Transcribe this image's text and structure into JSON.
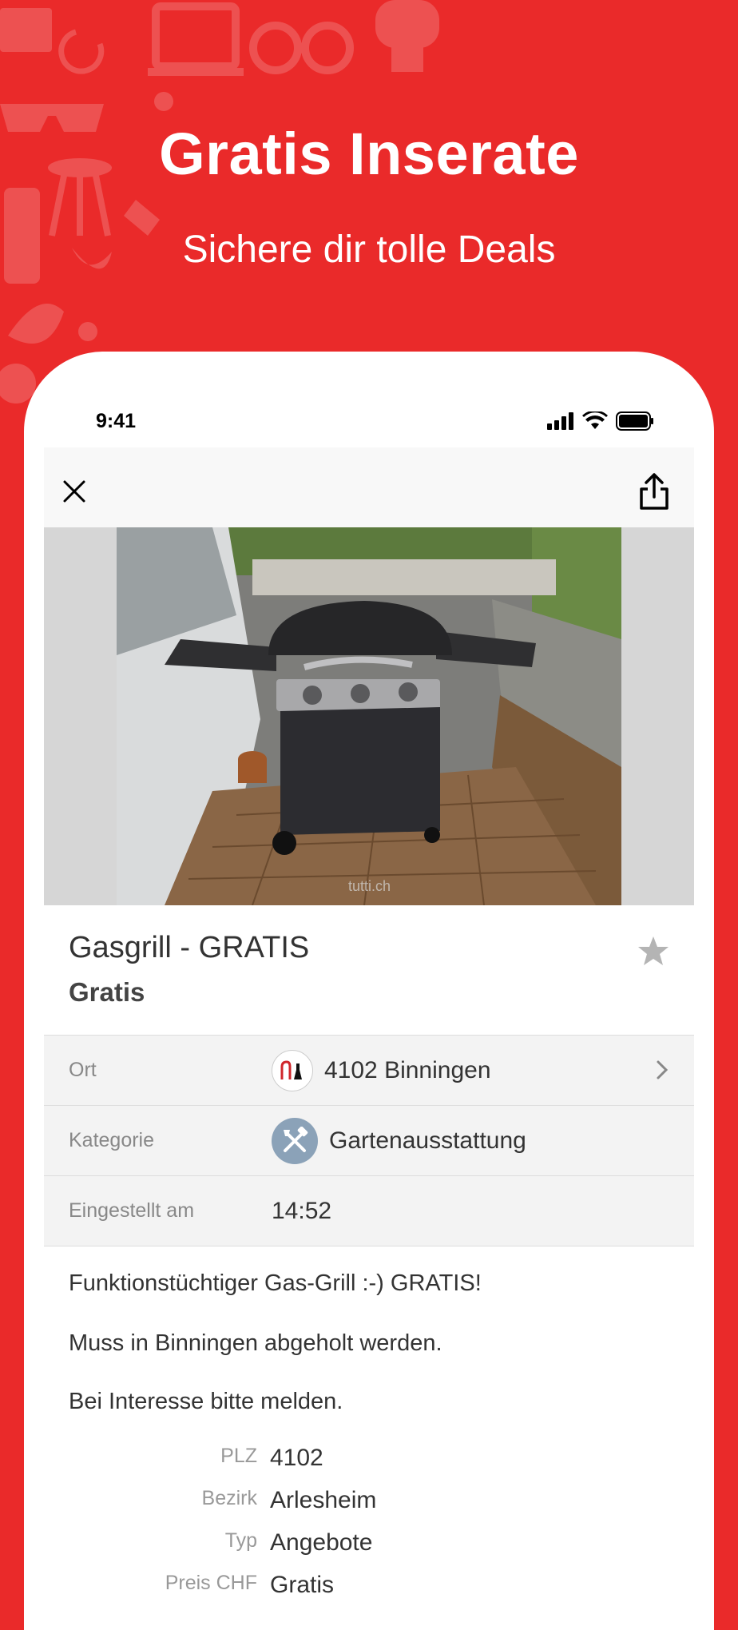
{
  "hero": {
    "title": "Gratis Inserate",
    "subtitle": "Sichere dir tolle Deals"
  },
  "colors": {
    "background": "#ea2a2a",
    "category_badge": "#8ba2b8"
  },
  "status_bar": {
    "time": "9:41",
    "icons": [
      "cellular-signal-icon",
      "wifi-icon",
      "battery-icon"
    ]
  },
  "nav": {
    "close_icon": "close-icon",
    "share_icon": "share-icon"
  },
  "photo": {
    "watermark": "tutti.ch"
  },
  "listing": {
    "title": "Gasgrill - GRATIS",
    "price": "Gratis",
    "favorite_icon": "star-icon"
  },
  "info_rows": [
    {
      "label": "Ort",
      "value": "4102 Binningen",
      "icon": "canton-coat-of-arms-icon"
    },
    {
      "label": "Kategorie",
      "value": "Gartenausstattung",
      "icon": "garden-tools-icon"
    },
    {
      "label": "Eingestellt am",
      "value": "14:52"
    }
  ],
  "description": [
    "Funktionstüchtiger Gas-Grill :-) GRATIS!",
    "Muss in Binningen abgeholt werden.",
    "Bei Interesse bitte melden."
  ],
  "details": [
    {
      "label": "PLZ",
      "value": "4102"
    },
    {
      "label": "Bezirk",
      "value": "Arlesheim"
    },
    {
      "label": "Typ",
      "value": "Angebote"
    },
    {
      "label": "Preis CHF",
      "value": "Gratis"
    }
  ]
}
